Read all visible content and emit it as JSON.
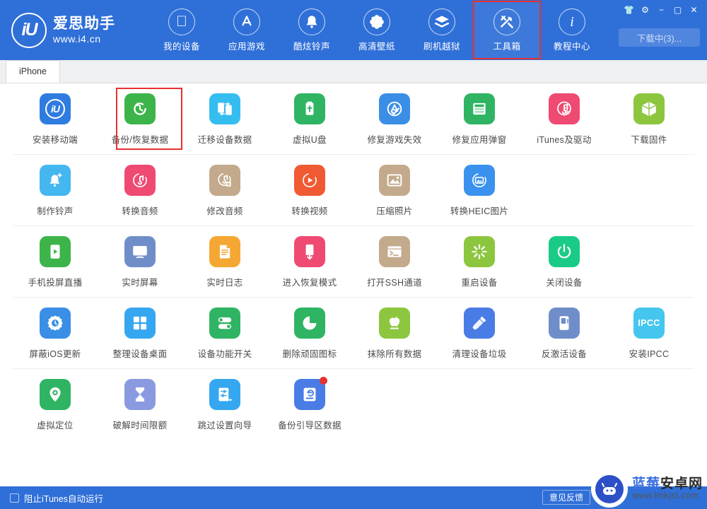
{
  "colors": {
    "header_blue": "#2f6fd8",
    "highlight_red": "#e8302f",
    "content_bg": "#ffffff"
  },
  "header": {
    "logo": {
      "mark": "iU",
      "name": "爱思助手",
      "url": "www.i4.cn"
    },
    "nav": [
      {
        "label": "我的设备",
        "icon": "apple-icon",
        "selected": false
      },
      {
        "label": "应用游戏",
        "icon": "appstore-icon",
        "selected": false
      },
      {
        "label": "酷炫铃声",
        "icon": "bell-icon",
        "selected": false
      },
      {
        "label": "高清壁纸",
        "icon": "flower-icon",
        "selected": false
      },
      {
        "label": "刷机越狱",
        "icon": "box-open-icon",
        "selected": false
      },
      {
        "label": "工具箱",
        "icon": "tools-icon",
        "selected": true
      },
      {
        "label": "教程中心",
        "icon": "info-icon",
        "selected": false
      }
    ],
    "window_controls": [
      {
        "name": "skin-icon",
        "glyph": "👕"
      },
      {
        "name": "settings-gear-icon",
        "glyph": "⚙"
      },
      {
        "name": "minimize-icon",
        "glyph": "−"
      },
      {
        "name": "maximize-icon",
        "glyph": "▢"
      },
      {
        "name": "close-icon",
        "glyph": "✕"
      }
    ],
    "download_button": "下载中(3)..."
  },
  "tabbar": {
    "tabs": [
      {
        "label": "iPhone",
        "active": true
      }
    ]
  },
  "sections": [
    {
      "name": "data-tools",
      "items": [
        {
          "label": "安装移动端",
          "icon": "i4-app-icon",
          "tile": "#2f7ce0",
          "highlight": false
        },
        {
          "label": "备份/恢复数据",
          "icon": "backup-restore-icon",
          "tile": "#3cb44a",
          "highlight": true
        },
        {
          "label": "迁移设备数据",
          "icon": "device-migrate-icon",
          "tile": "#35bdf0",
          "highlight": false
        },
        {
          "label": "虚拟U盘",
          "icon": "usb-drive-icon",
          "tile": "#2fb463",
          "highlight": false
        },
        {
          "label": "修复游戏失效",
          "icon": "appstore-fix-icon",
          "tile": "#3a8ee6",
          "highlight": false
        },
        {
          "label": "修复应用弹窗",
          "icon": "apple-id-icon",
          "tile": "#2fb463",
          "highlight": false
        },
        {
          "label": "iTunes及驱动",
          "icon": "itunes-icon",
          "tile": "#ef4a72",
          "highlight": false
        },
        {
          "label": "下载固件",
          "icon": "firmware-box-icon",
          "tile": "#8cc63f",
          "highlight": false
        }
      ]
    },
    {
      "name": "media-tools",
      "items": [
        {
          "label": "制作铃声",
          "icon": "ringtone-add-icon",
          "tile": "#45b7f0",
          "highlight": false
        },
        {
          "label": "转换音频",
          "icon": "audio-convert-icon",
          "tile": "#ef4a72",
          "highlight": false
        },
        {
          "label": "修改音频",
          "icon": "audio-edit-icon",
          "tile": "#c3aa8c",
          "highlight": false
        },
        {
          "label": "转换视频",
          "icon": "video-convert-icon",
          "tile": "#f05a32",
          "highlight": false
        },
        {
          "label": "压缩照片",
          "icon": "photo-compress-icon",
          "tile": "#c3aa8c",
          "highlight": false
        },
        {
          "label": "转换HEIC图片",
          "icon": "heic-convert-icon",
          "tile": "#3a92ee",
          "highlight": false
        }
      ]
    },
    {
      "name": "device-control-tools",
      "items": [
        {
          "label": "手机投屏直播",
          "icon": "screen-cast-icon",
          "tile": "#3cb44a",
          "highlight": false
        },
        {
          "label": "实时屏幕",
          "icon": "live-screen-icon",
          "tile": "#6f8ec9",
          "highlight": false
        },
        {
          "label": "实时日志",
          "icon": "live-log-icon",
          "tile": "#f4a833",
          "highlight": false
        },
        {
          "label": "进入恢复模式",
          "icon": "recovery-mode-icon",
          "tile": "#ef4a72",
          "highlight": false
        },
        {
          "label": "打开SSH通道",
          "icon": "ssh-terminal-icon",
          "tile": "#c3aa8c",
          "highlight": false
        },
        {
          "label": "重启设备",
          "icon": "reboot-icon",
          "tile": "#8cc63f",
          "highlight": false
        },
        {
          "label": "关闭设备",
          "icon": "power-off-icon",
          "tile": "#19cb86",
          "highlight": false
        }
      ]
    },
    {
      "name": "system-tools",
      "items": [
        {
          "label": "屏蔽iOS更新",
          "icon": "block-ios-update-icon",
          "tile": "#3a8ee6",
          "highlight": false
        },
        {
          "label": "整理设备桌面",
          "icon": "desktop-arrange-icon",
          "tile": "#35a7f0",
          "highlight": false
        },
        {
          "label": "设备功能开关",
          "icon": "feature-toggle-icon",
          "tile": "#2fb463",
          "highlight": false
        },
        {
          "label": "删除顽固图标",
          "icon": "remove-icon-icon",
          "tile": "#2fb463",
          "highlight": false
        },
        {
          "label": "抹除所有数据",
          "icon": "erase-all-icon",
          "tile": "#8cc63f",
          "highlight": false
        },
        {
          "label": "清理设备垃圾",
          "icon": "clean-junk-icon",
          "tile": "#4a7ce6",
          "highlight": false
        },
        {
          "label": "反激活设备",
          "icon": "deactivate-icon",
          "tile": "#6f8ec9",
          "highlight": false
        },
        {
          "label": "安装IPCC",
          "icon": "ipcc-icon",
          "tile": "#45c6ee",
          "highlight": false,
          "text": "IPCC"
        }
      ]
    },
    {
      "name": "advanced-tools",
      "items": [
        {
          "label": "虚拟定位",
          "icon": "virtual-location-icon",
          "tile": "#2fb463",
          "highlight": false
        },
        {
          "label": "破解时间限额",
          "icon": "time-limit-icon",
          "tile": "#8a9ae0",
          "highlight": false
        },
        {
          "label": "跳过设置向导",
          "icon": "skip-setup-icon",
          "tile": "#35a7f0",
          "highlight": false
        },
        {
          "label": "备份引导区数据",
          "icon": "backup-boot-icon",
          "tile": "#4a7ce6",
          "highlight": false,
          "badge": true
        }
      ]
    }
  ],
  "footer": {
    "checkbox_label": "阻止iTunes自动运行",
    "checkbox_checked": false,
    "feedback_button": "意见反馈",
    "watermark": {
      "name_a": "蓝莓",
      "name_b": "安卓网",
      "url": "www.lmkjst.com"
    }
  }
}
